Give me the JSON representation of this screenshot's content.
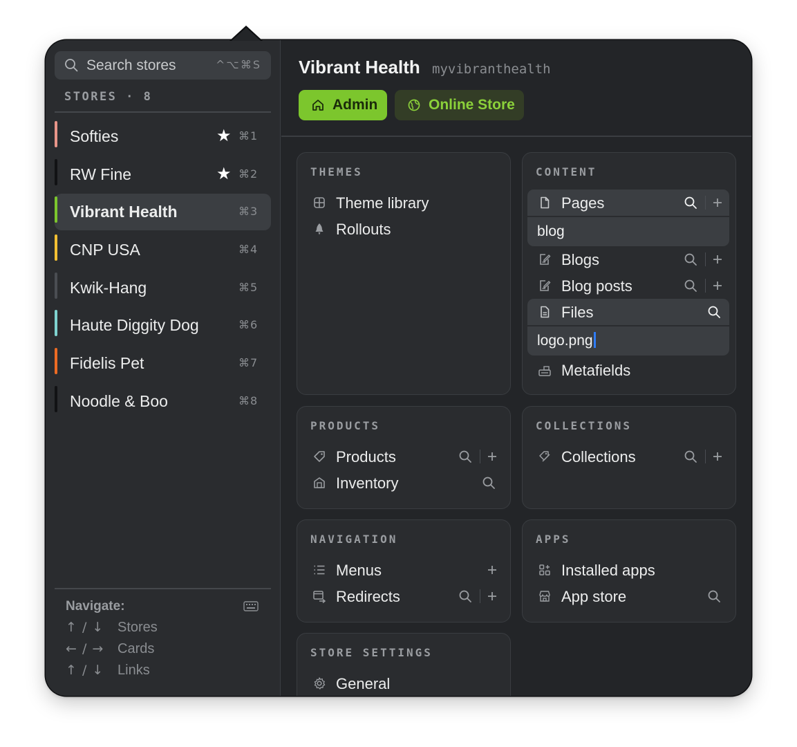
{
  "search": {
    "placeholder": "Search stores",
    "shortcut": "^⌥⌘S"
  },
  "stores": {
    "header": "STORES · 8",
    "items": [
      {
        "name": "Softies",
        "color": "#e8958a",
        "starred": true,
        "shortcut": "⌘1"
      },
      {
        "name": "RW Fine",
        "color": "#111214",
        "starred": true,
        "shortcut": "⌘2"
      },
      {
        "name": "Vibrant Health",
        "color": "#7cc62d",
        "starred": false,
        "shortcut": "⌘3",
        "active": true
      },
      {
        "name": "CNP USA",
        "color": "#f3c033",
        "starred": false,
        "shortcut": "⌘4"
      },
      {
        "name": "Kwik-Hang",
        "color": "#4a4d52",
        "starred": false,
        "shortcut": "⌘5"
      },
      {
        "name": "Haute Diggity Dog",
        "color": "#7fd3d0",
        "starred": false,
        "shortcut": "⌘6"
      },
      {
        "name": "Fidelis Pet",
        "color": "#ec6b24",
        "starred": false,
        "shortcut": "⌘7"
      },
      {
        "name": "Noodle & Boo",
        "color": "#111214",
        "starred": false,
        "shortcut": "⌘8"
      }
    ]
  },
  "navigate": {
    "title": "Navigate:",
    "rows": [
      {
        "keys": "↑ / ↓",
        "label": "Stores"
      },
      {
        "keys": "← / →",
        "label": "Cards"
      },
      {
        "keys": "↑ / ↓",
        "label": "Links"
      }
    ]
  },
  "header": {
    "store_name": "Vibrant Health",
    "store_handle": "myvibranthealth",
    "admin_label": "Admin",
    "online_store_label": "Online Store",
    "accent": "#7cc62d"
  },
  "cards": {
    "themes": {
      "title": "THEMES",
      "links": [
        "Theme library",
        "Rollouts"
      ]
    },
    "content": {
      "title": "CONTENT",
      "pages": "Pages",
      "pages_input": "blog",
      "blogs": "Blogs",
      "blog_posts": "Blog posts",
      "files": "Files",
      "files_input": "logo.png",
      "metafields": "Metafields"
    },
    "products": {
      "title": "PRODUCTS",
      "links": [
        "Products",
        "Inventory"
      ]
    },
    "collections": {
      "title": "COLLECTIONS",
      "links": [
        "Collections"
      ]
    },
    "navigation": {
      "title": "NAVIGATION",
      "links": [
        "Menus",
        "Redirects"
      ]
    },
    "apps": {
      "title": "APPS",
      "links": [
        "Installed apps",
        "App store"
      ]
    },
    "store_settings": {
      "title": "STORE SETTINGS",
      "links": [
        "General"
      ]
    }
  }
}
